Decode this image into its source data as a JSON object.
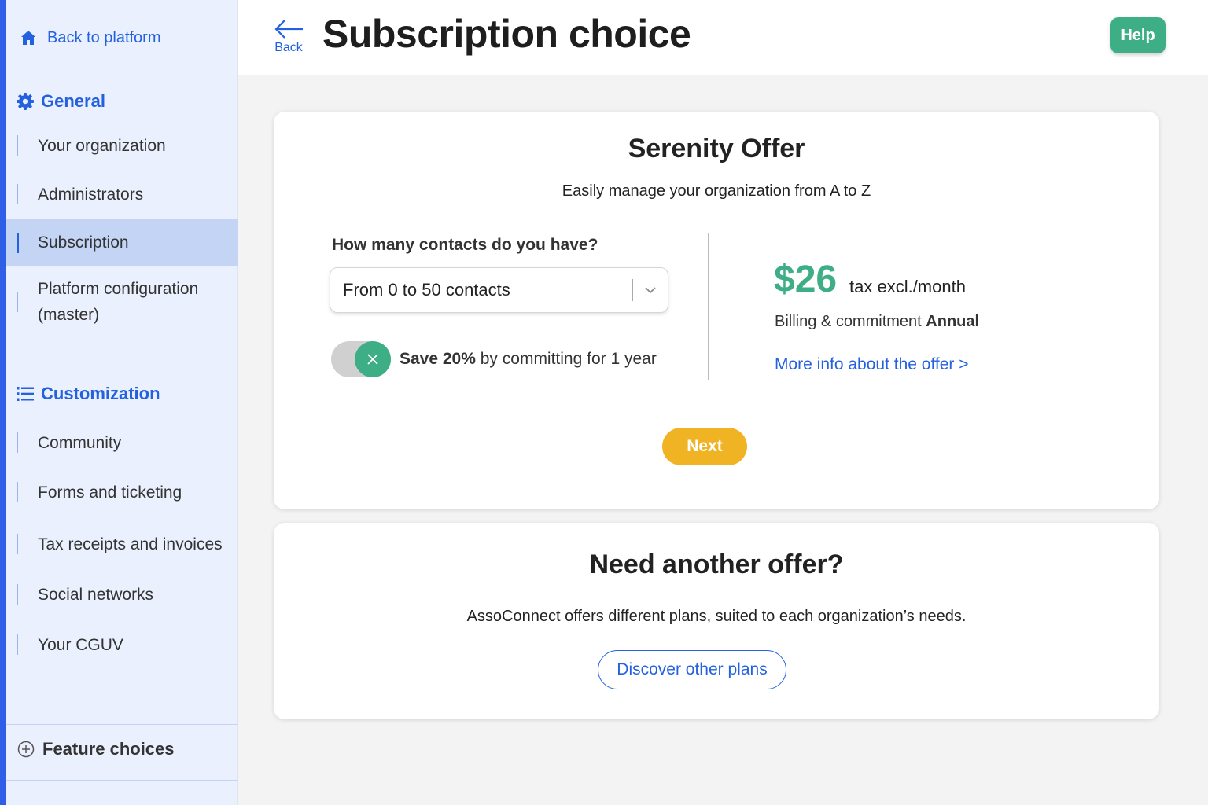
{
  "sidebar": {
    "back_label": "Back to platform",
    "general_heading": "General",
    "general_items": [
      {
        "label": "Your organization"
      },
      {
        "label": "Administrators"
      },
      {
        "label": "Subscription",
        "active": true
      },
      {
        "label": "Platform configuration\n(master)"
      }
    ],
    "customization_heading": "Customization",
    "customization_items": [
      {
        "label": "Community"
      },
      {
        "label": "Forms and ticketing"
      },
      {
        "label": "Tax receipts and invoices"
      },
      {
        "label": "Social networks"
      },
      {
        "label": "Your CGUV"
      }
    ],
    "feature_choices": "Feature choices"
  },
  "header": {
    "back_label": "Back",
    "title": "Subscription choice",
    "help_label": "Help"
  },
  "offer": {
    "title": "Serenity Offer",
    "subtitle": "Easily manage your organization from A to Z",
    "contacts_question": "How many contacts do you have?",
    "contacts_selected": "From 0 to 50 contacts",
    "toggle_on": true,
    "save_bold": "Save 20%",
    "save_rest": " by committing for 1 year",
    "price": "$26",
    "price_unit": "tax excl./month",
    "billing_prefix": "Billing & commitment ",
    "billing_value": "Annual",
    "more_info": "More info about the offer >",
    "next_label": "Next"
  },
  "other_offer": {
    "title": "Need another offer?",
    "text": "AssoConnect offers different plans, suited to each organization’s needs.",
    "button": "Discover other plans"
  },
  "colors": {
    "brand_blue": "#2461e0",
    "green": "#3dae85",
    "yellow": "#f0b323",
    "sidebar_bg": "#eaf0fd"
  },
  "icons": [
    "home-icon",
    "gear-icon",
    "list-icon",
    "plus-circle-icon",
    "arrow-left-icon",
    "chevron-down-icon",
    "close-icon"
  ]
}
